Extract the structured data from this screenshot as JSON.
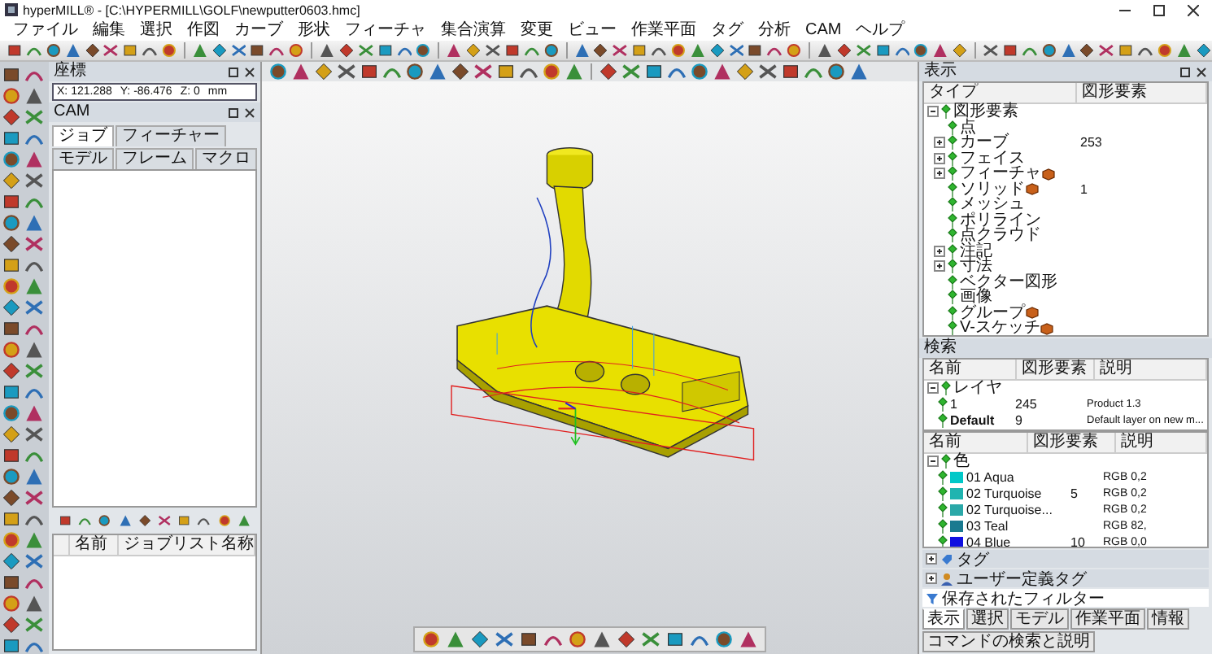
{
  "window": {
    "title": "hyperMILL® - [C:\\HYPERMILL\\GOLF\\newputter0603.hmc]"
  },
  "menu": [
    "ファイル",
    "編集",
    "選択",
    "作図",
    "カーブ",
    "形状",
    "フィーチャ",
    "集合演算",
    "変更",
    "ビュー",
    "作業平面",
    "タグ",
    "分析",
    "CAM",
    "ヘルプ"
  ],
  "coordinates": {
    "title": "座標",
    "fields": [
      {
        "label": "X:",
        "value": "121.288"
      },
      {
        "label": "Y:",
        "value": "-86.476"
      },
      {
        "label": "Z:",
        "value": "0"
      }
    ],
    "unit": "mm"
  },
  "cam_panel": {
    "title": "CAM",
    "tabs": [
      {
        "label": "ジョブ",
        "selected": true
      },
      {
        "label": "フィーチャー",
        "selected": false
      },
      {
        "label": "モデル",
        "selected": false
      },
      {
        "label": "フレーム",
        "selected": false
      },
      {
        "label": "マクロ",
        "selected": false
      }
    ],
    "columns": [
      "名前",
      "ジョブリスト名称"
    ]
  },
  "display_panel": {
    "title": "表示",
    "columns": [
      "タイプ",
      "図形要素"
    ],
    "tree": {
      "label": "図形要素",
      "expanded": true,
      "children": [
        {
          "label": "点",
          "kind": "leaf",
          "object_icon": false
        },
        {
          "label": "カーブ",
          "kind": "folder",
          "count": "253",
          "object_icon": false
        },
        {
          "label": "フェイス",
          "kind": "folder",
          "object_icon": false
        },
        {
          "label": "フィーチャ",
          "kind": "folder",
          "object_icon": true
        },
        {
          "label": "ソリッド",
          "kind": "leaf",
          "count": "1",
          "object_icon": true
        },
        {
          "label": "メッシュ",
          "kind": "leaf",
          "object_icon": false
        },
        {
          "label": "ポリライン",
          "kind": "leaf",
          "object_icon": false
        },
        {
          "label": "点クラウド",
          "kind": "leaf",
          "object_icon": false
        },
        {
          "label": "注記",
          "kind": "folder",
          "object_icon": false
        },
        {
          "label": "寸法",
          "kind": "folder",
          "object_icon": false
        },
        {
          "label": "ベクター図形",
          "kind": "leaf",
          "object_icon": false
        },
        {
          "label": "画像",
          "kind": "leaf",
          "object_icon": false
        },
        {
          "label": "グループ",
          "kind": "leaf",
          "object_icon": true
        },
        {
          "label": "V-スケッチ",
          "kind": "leaf",
          "object_icon": true
        }
      ]
    }
  },
  "layer_panel": {
    "title": "検索",
    "columns": [
      "名前",
      "図形要素",
      "説明"
    ],
    "tree": {
      "label": "レイヤ",
      "expanded": true,
      "children": [
        {
          "label": "1",
          "count": "245",
          "description": "Product 1.3",
          "active": false
        },
        {
          "label": "Default",
          "count": "9",
          "description": "Default layer on new m...",
          "active": true
        }
      ]
    }
  },
  "color_panel": {
    "columns": [
      "名前",
      "図形要素",
      "説明"
    ],
    "tree": {
      "label": "色",
      "expanded": true,
      "children": [
        {
          "label": "01 Aqua",
          "color": "#00c8c8",
          "description": "RGB 0,2"
        },
        {
          "label": "02 Turquoise",
          "count": "5",
          "color": "#20b4b0",
          "description": "RGB 0,2"
        },
        {
          "label": "02 Turquoise...",
          "color": "#2aa8a8",
          "description": "RGB 0,2"
        },
        {
          "label": "03 Teal",
          "color": "#1a7a90",
          "description": "RGB 82,"
        },
        {
          "label": "04 Blue",
          "count": "10",
          "color": "#1010e0",
          "description": "RGB 0,0"
        }
      ]
    },
    "sections": [
      {
        "label": "タグ",
        "kind": "tag"
      },
      {
        "label": "ユーザー定義タグ",
        "kind": "user"
      },
      {
        "label": "保存されたフィルター",
        "kind": "filter"
      }
    ],
    "tabs": [
      {
        "label": "表示",
        "selected": true
      },
      {
        "label": "選択",
        "selected": false
      },
      {
        "label": "モデル",
        "selected": false
      },
      {
        "label": "作業平面",
        "selected": false
      },
      {
        "label": "情報",
        "selected": false
      },
      {
        "label": "コマンドの検索と説明",
        "selected": false
      }
    ]
  }
}
